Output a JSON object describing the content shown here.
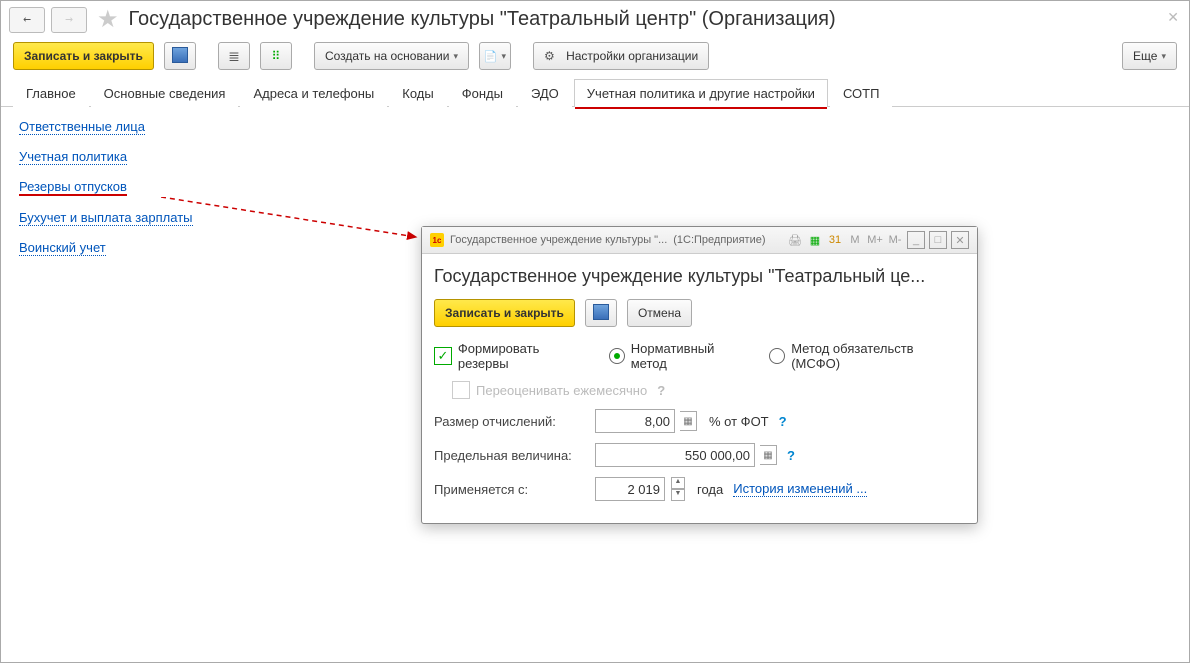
{
  "header": {
    "title": "Государственное учреждение культуры \"Театральный центр\" (Организация)"
  },
  "toolbar": {
    "save_close": "Записать и закрыть",
    "create_based": "Создать на основании",
    "org_settings": "Настройки организации",
    "more": "Еще"
  },
  "tabs": {
    "t0": "Главное",
    "t1": "Основные сведения",
    "t2": "Адреса и телефоны",
    "t3": "Коды",
    "t4": "Фонды",
    "t5": "ЭДО",
    "t6": "Учетная политика и другие настройки",
    "t7": "СОТП"
  },
  "links": {
    "l0": "Ответственные лица",
    "l1": "Учетная политика",
    "l2": "Резервы отпусков",
    "l3": "Бухучет и выплата зарплаты",
    "l4": "Воинский учет"
  },
  "dialog": {
    "titlebar_text": "Государственное учреждение культуры \"...",
    "titlebar_app": "(1С:Предприятие)",
    "heading": "Государственное учреждение культуры \"Театральный це...",
    "save_close": "Записать и закрыть",
    "cancel": "Отмена",
    "form_reserves": "Формировать резервы",
    "norm_method": "Нормативный метод",
    "ifrs_method": "Метод обязательств (МСФО)",
    "revalue_monthly": "Переоценивать ежемесячно",
    "accrual_label": "Размер отчислений:",
    "accrual_value": "8,00",
    "accrual_suffix": "% от ФОТ",
    "limit_label": "Предельная величина:",
    "limit_value": "550 000,00",
    "applies_label": "Применяется с:",
    "applies_year": "2 019",
    "applies_suffix": "года",
    "history": "История изменений ...",
    "m_labels": {
      "m1": "М",
      "m2": "М+",
      "m3": "М-"
    }
  }
}
